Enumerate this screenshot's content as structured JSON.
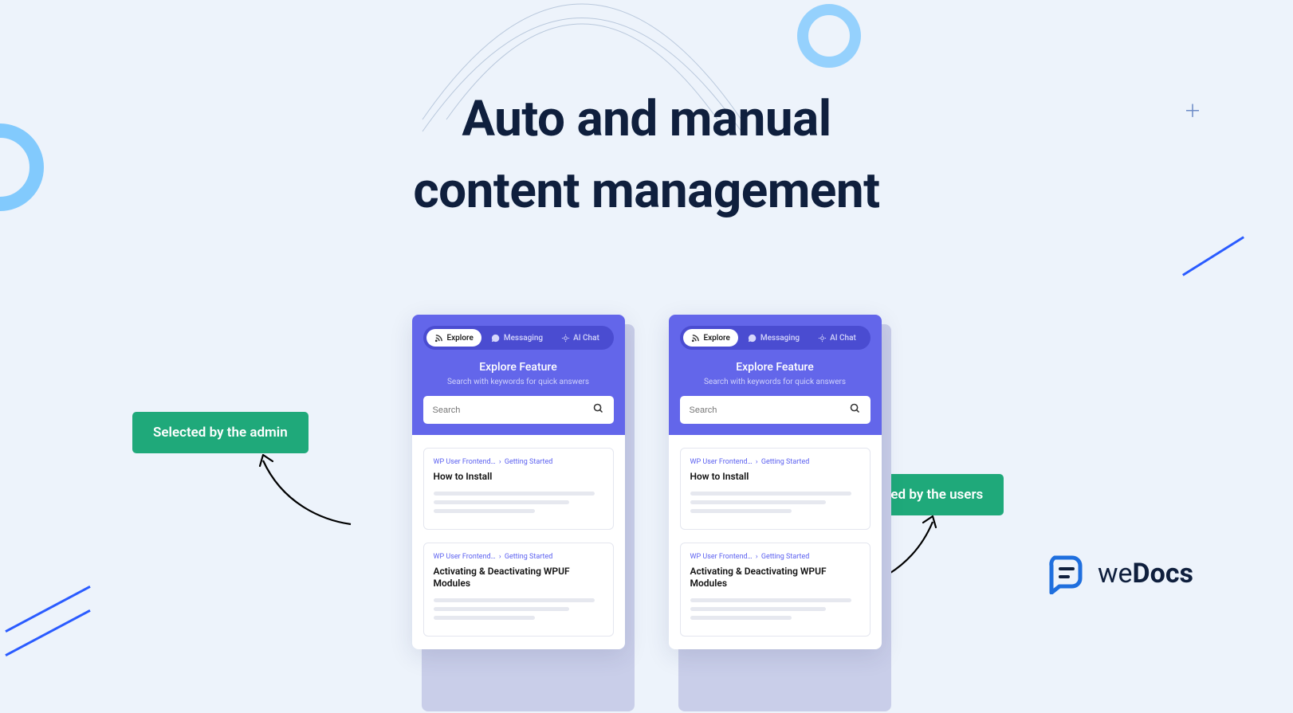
{
  "headline_line1": "Auto and manual",
  "headline_line2": "content management",
  "badge_left": "Selected by the admin",
  "badge_right": "Liked by the users",
  "panel": {
    "tabs": {
      "explore": "Explore",
      "messaging": "Messaging",
      "ai_chat": "AI Chat"
    },
    "title": "Explore Feature",
    "subtitle": "Search with keywords for quick answers",
    "search_placeholder": "Search",
    "cards": [
      {
        "breadcrumb_a": "WP User Frontend…",
        "breadcrumb_b": "Getting Started",
        "title": "How to Install"
      },
      {
        "breadcrumb_a": "WP User Frontend…",
        "breadcrumb_b": "Getting Started",
        "title": "Activating & Deactivating WPUF Modules"
      }
    ]
  },
  "logo": {
    "we": "we",
    "docs": "Docs"
  }
}
